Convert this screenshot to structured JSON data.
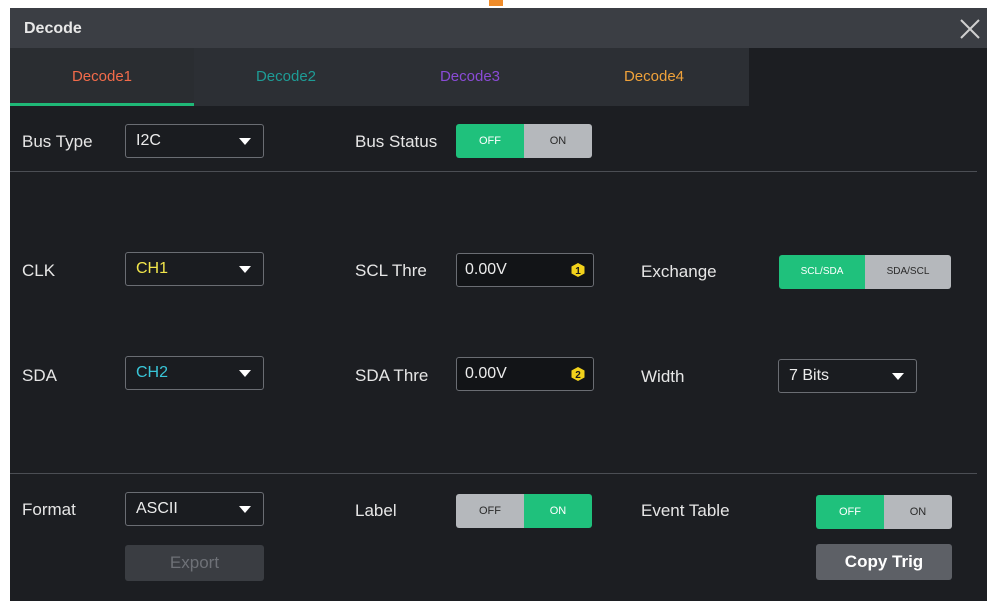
{
  "dialog": {
    "title": "Decode"
  },
  "tabs": [
    {
      "label": "Decode1",
      "color": "#f26b4a"
    },
    {
      "label": "Decode2",
      "color": "#1e9c96"
    },
    {
      "label": "Decode3",
      "color": "#8a4bd6"
    },
    {
      "label": "Decode4",
      "color": "#f0a23a"
    }
  ],
  "bus_type": {
    "label": "Bus Type",
    "value": "I2C"
  },
  "bus_status": {
    "label": "Bus Status",
    "off": "OFF",
    "on": "ON",
    "selected": "OFF"
  },
  "clk": {
    "label": "CLK",
    "value": "CH1",
    "value_color": "#f2e64b"
  },
  "sda": {
    "label": "SDA",
    "value": "CH2",
    "value_color": "#39c6d8"
  },
  "scl_thre": {
    "label": "SCL Thre",
    "value": "0.00V",
    "badge": "1"
  },
  "sda_thre": {
    "label": "SDA Thre",
    "value": "0.00V",
    "badge": "2"
  },
  "exchange": {
    "label": "Exchange",
    "opt1": "SCL/SDA",
    "opt2": "SDA/SCL",
    "selected": "SCL/SDA"
  },
  "width": {
    "label": "Width",
    "value": "7 Bits"
  },
  "format": {
    "label": "Format",
    "value": "ASCII"
  },
  "label_toggle": {
    "label": "Label",
    "off": "OFF",
    "on": "ON",
    "selected": "ON"
  },
  "event_table": {
    "label": "Event Table",
    "off": "OFF",
    "on": "ON",
    "selected": "OFF"
  },
  "buttons": {
    "export": "Export",
    "copy_trig": "Copy Trig"
  },
  "colors": {
    "accent_green": "#1fc17c",
    "badge_yellow": "#f2d21b"
  },
  "icons": {
    "close": "close-icon",
    "dropdown": "chevron-down-icon"
  }
}
